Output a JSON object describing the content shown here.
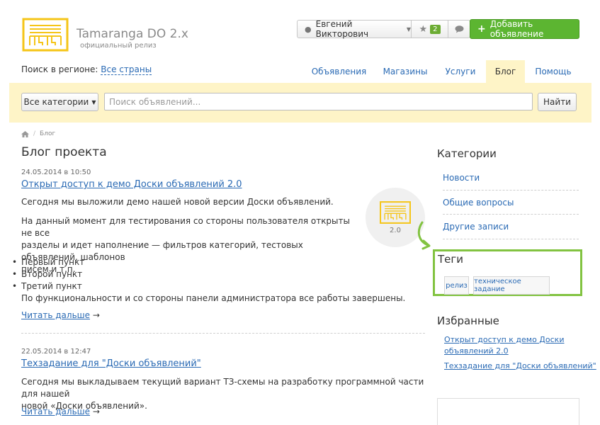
{
  "header": {
    "site_title": "Tamaranga DO 2.x",
    "site_subtitle": "официальный релиз",
    "user_name": "Евгений Викторович",
    "favorites_count": "2",
    "add_button": "Добавить объявление"
  },
  "region": {
    "label": "Поиск в регионе:",
    "value": "Все страны"
  },
  "nav": [
    {
      "label": "Объявления"
    },
    {
      "label": "Магазины"
    },
    {
      "label": "Услуги"
    },
    {
      "label": "Блог"
    },
    {
      "label": "Помощь"
    }
  ],
  "search": {
    "category_button": "Все категории",
    "placeholder": "Поиск объявлений...",
    "find_button": "Найти"
  },
  "breadcrumb": {
    "separator": "/",
    "current": "Блог"
  },
  "main": {
    "page_title": "Блог проекта",
    "posts": [
      {
        "date": "24.05.2014 в 10:50",
        "title": "Открыт доступ к демо Доски объявлений 2.0",
        "p1": "Сегодня мы выложили демо нашей новой версии Доски объявлений.",
        "p2_lines": [
          "На данный момент для тестирования со стороны пользователя открыты не все",
          "разделы и идет наполнение — фильтров категорий, тестовых объявлений, шаблонов",
          "писем и т.п."
        ],
        "points": [
          "Первый пункт",
          "Второй пункт",
          "Третий пункт"
        ],
        "p3": "По функциональности и со стороны панели администратора все работы завершены.",
        "read_more": "Читать дальше",
        "image_caption": "2.0"
      },
      {
        "date": "22.05.2014 в 12:47",
        "title": "Техзадание для \"Доски объявлений\"",
        "p1_lines": [
          "Сегодня мы выкладываем текущий вариант ТЗ-схемы на разработку программной части для нашей",
          "новой «Доски объявлений»."
        ],
        "read_more": "Читать дальше"
      }
    ],
    "arrow": "→"
  },
  "sidebar": {
    "categories_title": "Категории",
    "categories": [
      "Новости",
      "Общие вопросы",
      "Другие записи"
    ],
    "tags_title": "Теги",
    "tags": [
      "релиз",
      "техническое задание"
    ],
    "favorites_title": "Избранные",
    "favorites": [
      {
        "lines": [
          "Открыт доступ к демо Доски",
          "объявлений 2.0"
        ]
      },
      {
        "lines": [
          "Техзадание для \"Доски объявлений\""
        ]
      }
    ]
  },
  "colors": {
    "accent_green": "#5cb531",
    "highlight_yellow": "#fef4c7",
    "link_blue": "#2a6ab4",
    "logo_yellow": "#f5c518",
    "tags_frame_green": "#82c341"
  }
}
